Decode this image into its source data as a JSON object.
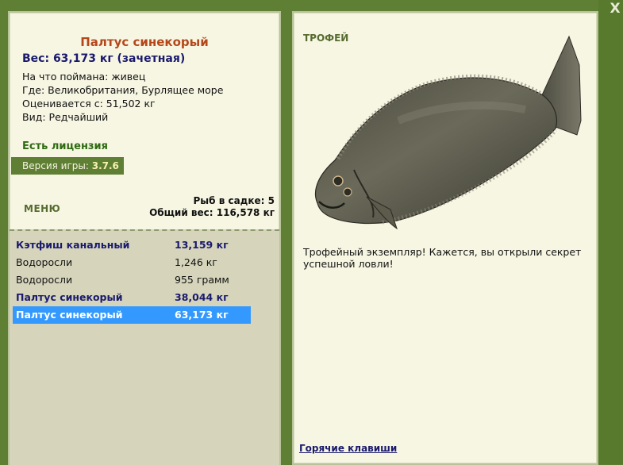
{
  "window": {
    "close_label": "X"
  },
  "catch": {
    "fish_name": "Палтус синекорый",
    "weight_line": "Вес: 63,173 кг (зачетная)",
    "bait_line": "На что поймана: живец",
    "location_line": "Где: Великобритания, Бурлящее море",
    "valued_line": "Оценивается с: 51,502 кг",
    "type_line": "Вид: Редчайший"
  },
  "license": {
    "label": "Есть лицензия"
  },
  "version": {
    "prefix": "Версия игры:",
    "value": "3.7.6"
  },
  "menu": {
    "label": "МЕНЮ"
  },
  "keepnet": {
    "count_line": "Рыб в садке: 5",
    "total_line": "Общий вес: 116,578 кг",
    "rows": [
      {
        "name": "Кэтфиш канальный",
        "weight": "13,159 кг",
        "style": "bold"
      },
      {
        "name": "Водоросли",
        "weight": "1,246 кг",
        "style": "normal"
      },
      {
        "name": "Водоросли",
        "weight": "955 грамм",
        "style": "normal"
      },
      {
        "name": "Палтус синекорый",
        "weight": "38,044 кг",
        "style": "bold"
      },
      {
        "name": "Палтус синекорый",
        "weight": "63,173 кг",
        "style": "selected"
      }
    ]
  },
  "trophy": {
    "label": "ТРОФЕЙ",
    "image_icon": "halibut-fish-image",
    "description": "Трофейный экземпляр! Кажется, вы открыли секрет успешной ловли!"
  },
  "footer": {
    "hotkeys_label": "Горячие клавиши"
  },
  "colors": {
    "frame_green": "#5f7f34",
    "panel_bg": "#f7f6e3",
    "list_bg": "#d6d5bc",
    "title_orange": "#b5471a",
    "navy": "#1a1a6e",
    "selection_blue": "#3399ff"
  }
}
